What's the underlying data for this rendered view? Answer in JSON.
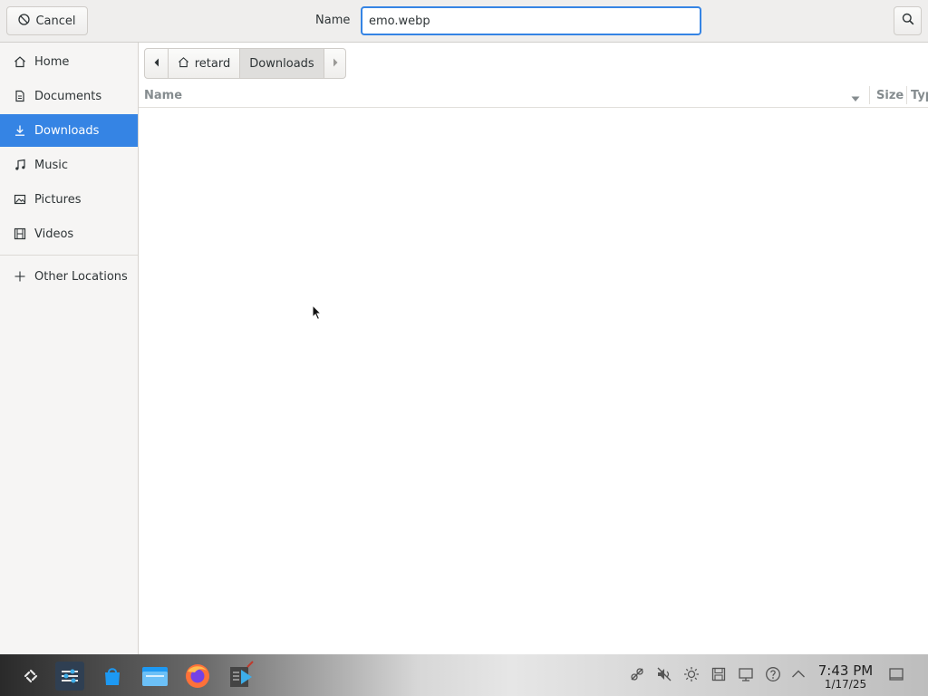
{
  "header": {
    "cancel_label": "Cancel",
    "name_label": "Name",
    "filename_value": "emo.webp"
  },
  "sidebar": {
    "items": [
      {
        "label": "Home",
        "icon": "home-icon"
      },
      {
        "label": "Documents",
        "icon": "document-icon"
      },
      {
        "label": "Downloads",
        "icon": "download-icon",
        "active": true
      },
      {
        "label": "Music",
        "icon": "music-icon"
      },
      {
        "label": "Pictures",
        "icon": "picture-icon"
      },
      {
        "label": "Videos",
        "icon": "video-icon"
      }
    ],
    "other_locations": "Other Locations"
  },
  "pathbar": {
    "segments": [
      "retard",
      "Downloads"
    ],
    "current": "Downloads"
  },
  "columns": {
    "name": "Name",
    "size": "Size",
    "type": "Typ"
  },
  "taskbar": {
    "time": "7:43 PM",
    "date": "1/17/25"
  },
  "colors": {
    "accent": "#3584e4"
  }
}
